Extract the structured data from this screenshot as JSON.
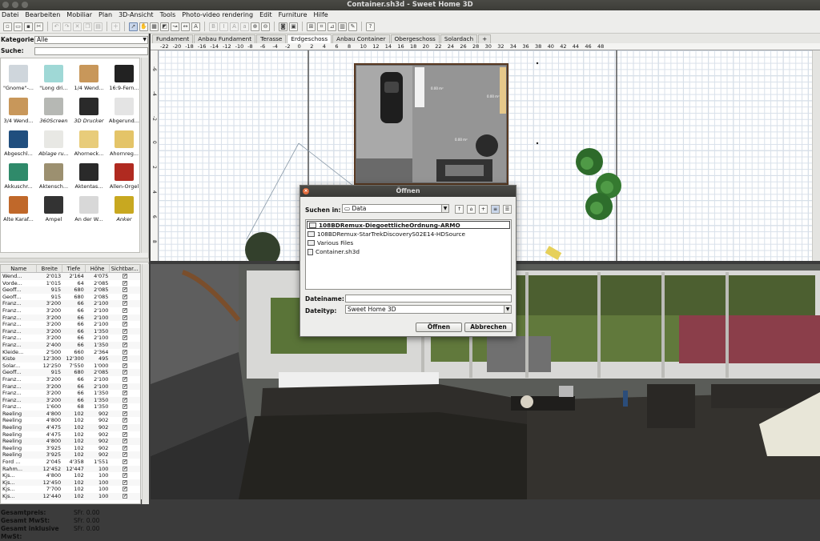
{
  "window": {
    "title": "Container.sh3d - Sweet Home 3D"
  },
  "menu": [
    "Datei",
    "Bearbeiten",
    "Mobiliar",
    "Plan",
    "3D-Ansicht",
    "Tools",
    "Photo-video rendering",
    "Edit",
    "Furniture",
    "Hilfe"
  ],
  "catalog": {
    "category_label": "Kategorie:",
    "category_value": "Alle",
    "search_label": "Suche:",
    "search_value": "",
    "items": [
      {
        "label": "\"Gnome\"-...",
        "color": "#cfd6dc",
        "italic": false
      },
      {
        "label": "\"Long dri...",
        "color": "#9fd8d6",
        "italic": false
      },
      {
        "label": "1/4 Wend...",
        "color": "#c8975a",
        "italic": false
      },
      {
        "label": "16:9-Fern...",
        "color": "#222222",
        "italic": false
      },
      {
        "label": "3/4 Wend...",
        "color": "#c8975a",
        "italic": false
      },
      {
        "label": "360Screen",
        "color": "#b6b8b4",
        "italic": true
      },
      {
        "label": "3D Drucker",
        "color": "#2a2a2a",
        "italic": true
      },
      {
        "label": "Abgerund...",
        "color": "#e4e4e4",
        "italic": false
      },
      {
        "label": "Abgeschl...",
        "color": "#204e7e",
        "italic": false
      },
      {
        "label": "Ablage ru...",
        "color": "#e8e8e4",
        "italic": true
      },
      {
        "label": "Ahorneck...",
        "color": "#e8cc7a",
        "italic": false
      },
      {
        "label": "Ahornreg...",
        "color": "#e4c468",
        "italic": false
      },
      {
        "label": "Akkuschr...",
        "color": "#2f8a6a",
        "italic": false
      },
      {
        "label": "Aktensch...",
        "color": "#9c9070",
        "italic": false
      },
      {
        "label": "Aktentas...",
        "color": "#2a2a2a",
        "italic": false
      },
      {
        "label": "Allen-Orgel",
        "color": "#b02a20",
        "italic": false
      },
      {
        "label": "Alte Karaf...",
        "color": "#c0682a",
        "italic": false
      },
      {
        "label": "Ampel",
        "color": "#333333",
        "italic": false
      },
      {
        "label": "An der W...",
        "color": "#d8d8d8",
        "italic": false
      },
      {
        "label": "Anker",
        "color": "#c8a820",
        "italic": true
      }
    ]
  },
  "furniture_table": {
    "headers": [
      "Name",
      "Breite",
      "Tiefe",
      "Höhe",
      "Sichtbar..."
    ],
    "rows": [
      [
        "Wend...",
        "2'013",
        "2'164",
        "4'075"
      ],
      [
        "Vorde...",
        "1'015",
        "64",
        "2'085"
      ],
      [
        "Geoff...",
        "915",
        "680",
        "2'085"
      ],
      [
        "Geoff...",
        "915",
        "680",
        "2'085"
      ],
      [
        "Franz...",
        "3'200",
        "66",
        "2'100"
      ],
      [
        "Franz...",
        "3'200",
        "66",
        "2'100"
      ],
      [
        "Franz...",
        "3'200",
        "66",
        "2'100"
      ],
      [
        "Franz...",
        "3'200",
        "66",
        "2'100"
      ],
      [
        "Franz...",
        "3'200",
        "66",
        "1'350"
      ],
      [
        "Franz...",
        "3'200",
        "66",
        "2'100"
      ],
      [
        "Franz...",
        "2'400",
        "66",
        "1'350"
      ],
      [
        "Kleide...",
        "2'500",
        "660",
        "2'364"
      ],
      [
        "Kiste",
        "12'300",
        "12'300",
        "495"
      ],
      [
        "Solar...",
        "12'250",
        "7'550",
        "1'000"
      ],
      [
        "Geoff...",
        "915",
        "680",
        "2'085"
      ],
      [
        "Franz...",
        "3'200",
        "66",
        "2'100"
      ],
      [
        "Franz...",
        "3'200",
        "66",
        "2'100"
      ],
      [
        "Franz...",
        "3'200",
        "66",
        "1'350"
      ],
      [
        "Franz...",
        "3'200",
        "66",
        "1'350"
      ],
      [
        "Franz...",
        "1'600",
        "68",
        "1'350"
      ],
      [
        "Reeling",
        "4'800",
        "102",
        "902"
      ],
      [
        "Reeling",
        "4'800",
        "102",
        "902"
      ],
      [
        "Reeling",
        "4'475",
        "102",
        "902"
      ],
      [
        "Reeling",
        "4'475",
        "102",
        "902"
      ],
      [
        "Reeling",
        "4'800",
        "102",
        "902"
      ],
      [
        "Reeling",
        "3'925",
        "102",
        "902"
      ],
      [
        "Reeling",
        "3'925",
        "102",
        "902"
      ],
      [
        "Ford ...",
        "2'045",
        "4'358",
        "1'551"
      ],
      [
        "Rahm...",
        "12'452",
        "12'447",
        "100"
      ],
      [
        "Kjs...",
        "4'800",
        "102",
        "100"
      ],
      [
        "Kjs...",
        "12'450",
        "102",
        "100"
      ],
      [
        "Kjs...",
        "7'700",
        "102",
        "100"
      ],
      [
        "Kjs...",
        "12'440",
        "102",
        "100"
      ]
    ]
  },
  "totals": [
    {
      "label": "Gesamtpreis:",
      "value": "SFr. 0.00"
    },
    {
      "label": "Gesamt MwSt:",
      "value": "SFr. 0.00"
    },
    {
      "label": "Gesamt inklusive MwSt:",
      "value": "SFr. 0.00"
    }
  ],
  "level_tabs": [
    "Fundament",
    "Anbau Fundament",
    "Terasse",
    "Erdgeschoss",
    "Anbau Container",
    "Obergeschoss",
    "Solardach"
  ],
  "active_tab": "Erdgeschoss",
  "add_tab": "+",
  "ruler_labels": [
    "-22",
    "-20",
    "-18",
    "-16",
    "-14",
    "-12",
    "-10",
    "-8",
    "-6",
    "-4",
    "-2",
    "0",
    "2",
    "4",
    "6",
    "8",
    "10",
    "12",
    "14",
    "16",
    "18",
    "20",
    "22",
    "24",
    "26",
    "28",
    "30",
    "32",
    "34",
    "36",
    "38",
    "40",
    "42",
    "44",
    "46",
    "48"
  ],
  "ruler_left_labels": [
    "-6",
    "-4",
    "-2",
    "0",
    "2",
    "4",
    "6",
    "8"
  ],
  "room_labels": [
    "0.00 m²",
    "0.00 m²",
    "0.00 m²"
  ],
  "dialog": {
    "title": "Öffnen",
    "look_in_label": "Suchen in:",
    "look_in_value": "Data",
    "files": [
      {
        "name": "108BDRemux-DiegoettlicheOrdnung-ARMO",
        "type": "folder",
        "selected": true
      },
      {
        "name": "108BDRemux-StarTrekDiscoveryS02E14-HDSource",
        "type": "folder",
        "selected": false
      },
      {
        "name": "Various Files",
        "type": "folder",
        "selected": false
      },
      {
        "name": "Container.sh3d",
        "type": "file",
        "selected": false
      }
    ],
    "filename_label": "Dateiname:",
    "filename_value": "",
    "filetype_label": "Dateityp:",
    "filetype_value": "Sweet Home 3D",
    "open_button": "Öffnen",
    "cancel_button": "Abbrechen"
  },
  "colors": {
    "sofa": "#2f2d2a",
    "grass": "#5e7a3a",
    "wall": "#d9d9d9"
  }
}
